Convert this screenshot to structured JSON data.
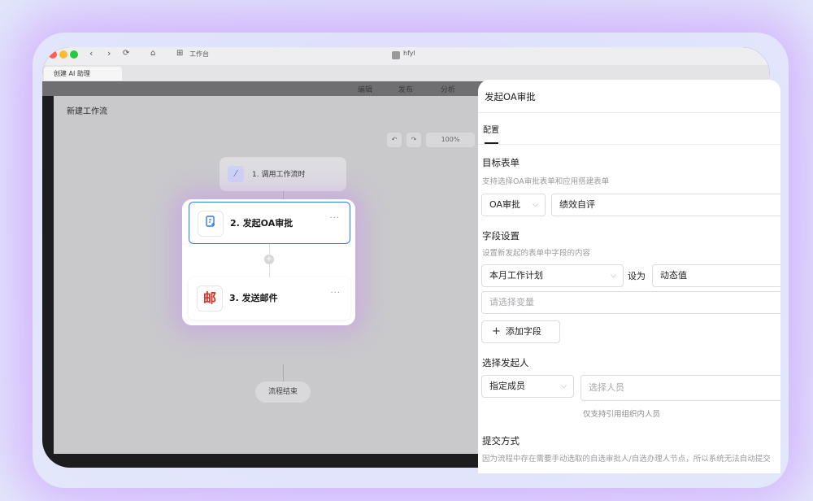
{
  "window": {
    "back_icon": "chevron-left-icon",
    "forward_icon": "chevron-right-icon",
    "workspace_label": "工作台",
    "app_name": "hfyl",
    "tab_label": "创建 AI 助理",
    "dim_tabs": [
      "编辑",
      "发布",
      "分析"
    ]
  },
  "canvas": {
    "title": "新建工作流",
    "zoom": "100%",
    "nodes": [
      {
        "label": "1. 调用工作流时",
        "icon": "workflow-icon"
      },
      {
        "label": "2. 发起OA审批",
        "icon": "approval-form-icon",
        "more": "···"
      },
      {
        "label": "3. 发送邮件",
        "icon": "mail-icon",
        "more": "···"
      }
    ],
    "end_label": "流程结束"
  },
  "panel": {
    "title": "发起OA审批",
    "tab": "配置",
    "target_form": {
      "title": "目标表单",
      "desc": "支持选择OA审批表单和应用搭建表单",
      "type_value": "OA审批",
      "form_value": "绩效自评"
    },
    "fields": {
      "title": "字段设置",
      "desc": "设置新发起的表单中字段的内容",
      "field_value": "本月工作计划",
      "set_as": "设为",
      "mode_value": "动态值",
      "variable_placeholder": "请选择变量",
      "add_field_label": "添加字段"
    },
    "initiator": {
      "title": "选择发起人",
      "type_value": "指定成员",
      "member_placeholder": "选择人员",
      "hint": "仅支持引用组织内人员"
    },
    "submit": {
      "title": "提交方式",
      "desc": "因为流程中存在需要手动选取的自选审批人/自选办理人节点，所以系统无法自动提交"
    }
  },
  "colors": {
    "accent": "#2e7cf6",
    "mail_red": "#d93026"
  }
}
